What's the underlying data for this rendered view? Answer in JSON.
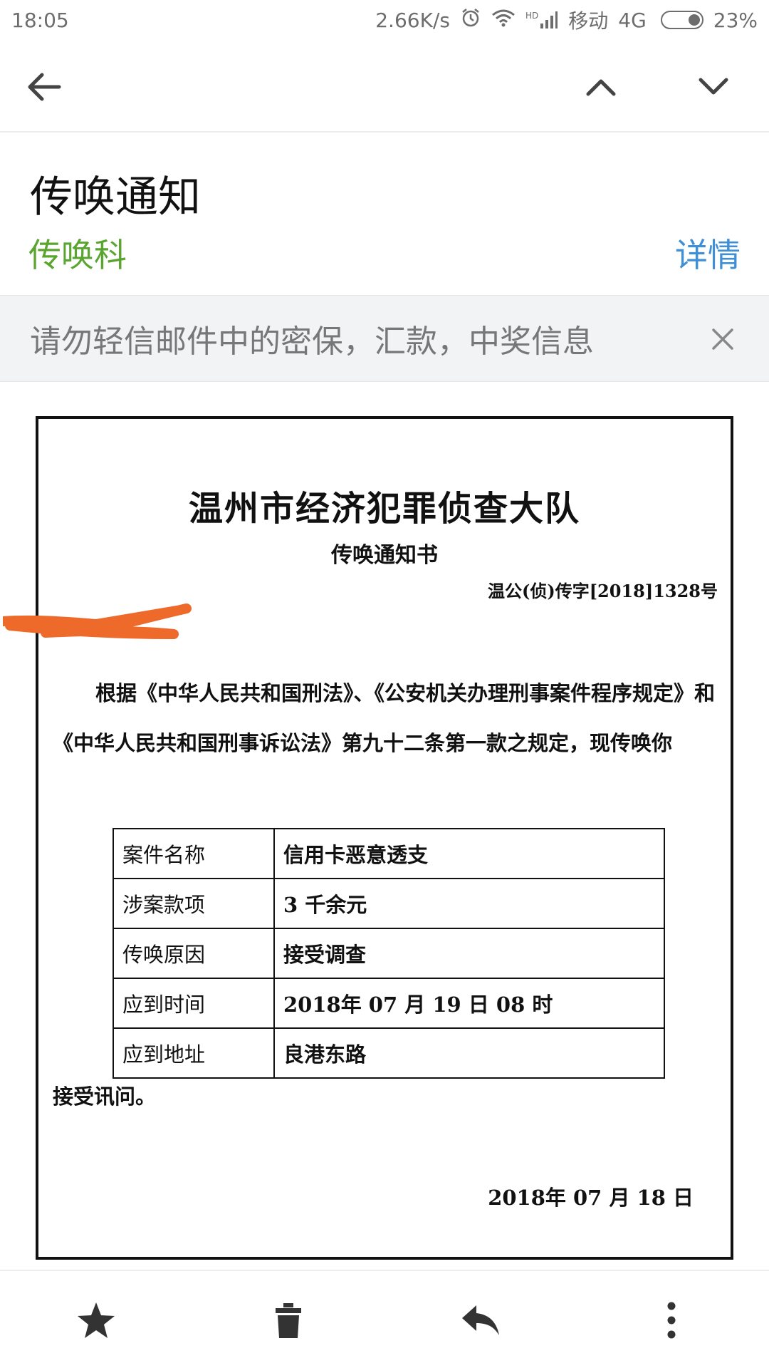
{
  "status_bar": {
    "time": "18:05",
    "net_speed": "2.66K/s",
    "hd": "HD",
    "carrier": "移动",
    "network": "4G",
    "battery": "23%"
  },
  "toolbar": {
    "back_icon": "arrow-left-icon",
    "prev_icon": "chevron-up-icon",
    "next_icon": "chevron-down-icon"
  },
  "email": {
    "subject": "传唤通知",
    "sender": "传唤科",
    "details_label": "详情"
  },
  "warning": {
    "text": "请勿轻信邮件中的密保，汇款，中奖信息",
    "close_icon": "close-icon"
  },
  "document": {
    "title": "温州市经济犯罪侦查大队",
    "subtitle": "传唤通知书",
    "number": "温公(侦)传字[2018]1328号",
    "body": "根据《中华人民共和国刑法》、《公安机关办理刑事案件程序规定》和《中华人民共和国刑事诉讼法》第九十二条第一款之规定，现传唤你",
    "table": [
      {
        "label": "案件名称",
        "value": "信用卡恶意透支"
      },
      {
        "label": "涉案款项",
        "value": "3 千余元"
      },
      {
        "label": "传唤原因",
        "value": "接受调查"
      },
      {
        "label": "应到时间",
        "value": "2018年 07 月 19 日 08 时"
      },
      {
        "label": "应到地址",
        "value": "良港东路"
      }
    ],
    "closing": "接受讯问。",
    "date": "2018年 07 月 18 日"
  },
  "bottom_bar": {
    "star_icon": "star-icon",
    "delete_icon": "trash-icon",
    "reply_icon": "reply-icon",
    "more_icon": "more-vertical-icon"
  },
  "colors": {
    "sender_green": "#5aa52f",
    "details_blue": "#3e8fd6",
    "warning_bg": "#f1f3f5",
    "redaction_orange": "#ee6a2a"
  }
}
